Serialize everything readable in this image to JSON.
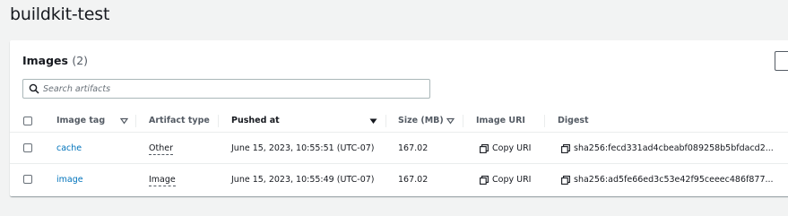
{
  "page": {
    "title": "buildkit-test"
  },
  "panel": {
    "title": "Images",
    "count": "(2)",
    "search_placeholder": "Search artifacts"
  },
  "table": {
    "columns": [
      "Image tag",
      "Artifact type",
      "Pushed at",
      "Size (MB)",
      "Image URI",
      "Digest"
    ],
    "rows": [
      {
        "image_tag": "cache",
        "artifact_type": "Other",
        "pushed_at": "June 15, 2023, 10:55:51 (UTC-07)",
        "size_mb": "167.02",
        "image_uri": "Copy URI",
        "digest": "sha256:fecd331ad4cbeabf089258b5bfdacd2..."
      },
      {
        "image_tag": "image",
        "artifact_type": "Image",
        "pushed_at": "June 15, 2023, 10:55:49 (UTC-07)",
        "size_mb": "167.02",
        "image_uri": "Copy URI",
        "digest": "sha256:ad5fe66ed3c53e42f95ceeec486f877..."
      }
    ]
  },
  "icons": {
    "search": "search-icon",
    "copy": "copy-icon",
    "sort": "sort-caret-icon"
  },
  "colors": {
    "link": "#0073bb",
    "background": "#f2f3f3",
    "text": "#16191f"
  }
}
